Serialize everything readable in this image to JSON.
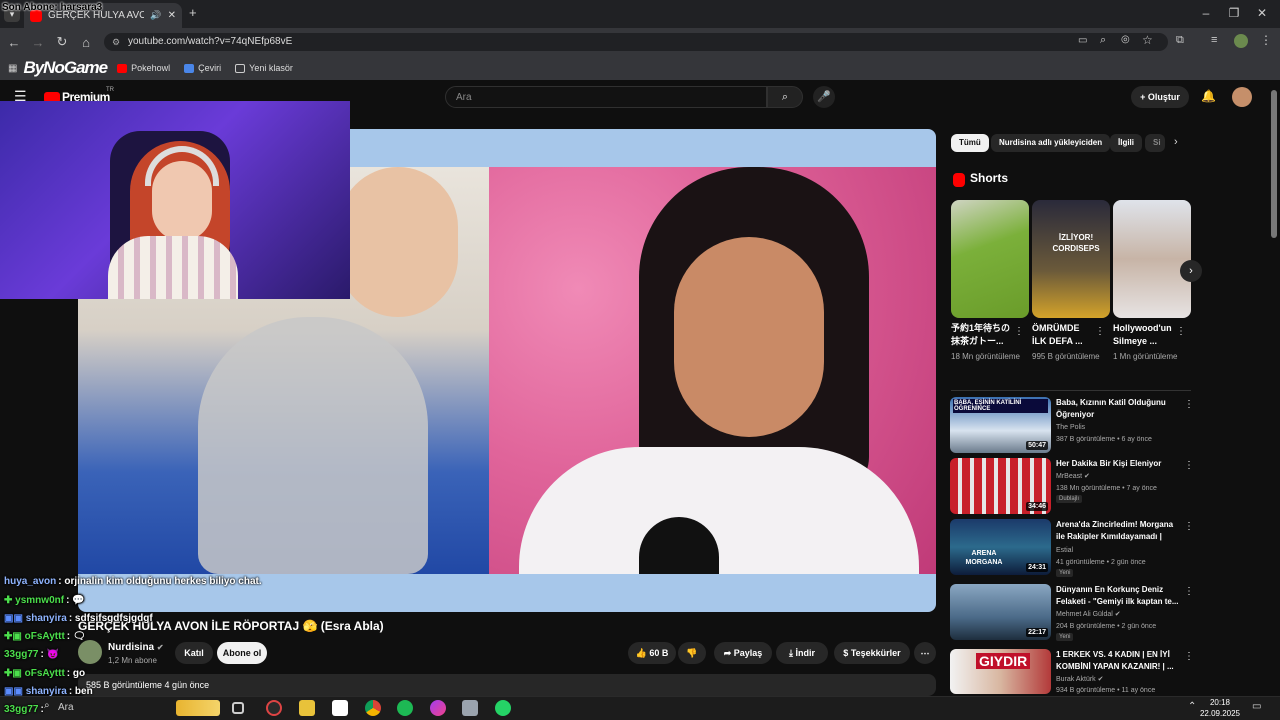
{
  "overlay": {
    "stream_title": "Son Abone: harsara3"
  },
  "browser": {
    "tab_title": "GERÇEK HULYA AVON İLE R",
    "new_tab": "+",
    "url": "youtube.com/watch?v=74qNEfp68vE",
    "bookmarks": [
      "Pokehowl",
      "Çeviri",
      "Yeni klasör"
    ],
    "brand_logo": "ByNoGame"
  },
  "youtube": {
    "brand": "Premium",
    "brand_sup": "TR",
    "search_placeholder": "Ara",
    "create_label": "Oluştur"
  },
  "video": {
    "title": "GERÇEK HULYA AVON İLE RÖPORTAJ 🫣 (Esra Abla)",
    "channel": "Nurdisina",
    "verified": "✔",
    "subscribers": "1,2 Mn abone",
    "join_label": "Katıl",
    "subscribe_label": "Abone ol",
    "likes": "60 B",
    "share_label": "Paylaş",
    "download_label": "İndir",
    "thanks_label": "Teşekkürler",
    "more_label": "⋯",
    "description_stats": "585 B görüntüleme  4 gün önce"
  },
  "chips": [
    "Tümü",
    "Nurdisina adlı yükleyiciden",
    "İlgili",
    "Si"
  ],
  "shorts": {
    "heading": "Shorts",
    "items": [
      {
        "title": "予約1年待ちの抹茶ガトー...",
        "views": "18 Mn görüntüleme"
      },
      {
        "title": "ÖMRÜMDE İLK DEFA ...",
        "views": "995 B görüntüleme",
        "thumb_text": "İZLİYOR! CORDISEPS"
      },
      {
        "title": "Hollywood'un Silmeye ...",
        "views": "1 Mn görüntüleme"
      }
    ]
  },
  "recommendations": [
    {
      "title": "Baba, Kızının Katil Olduğunu Öğreniyor",
      "channel": "The Polis",
      "meta": "387 B görüntüleme • 6 ay önce",
      "duration": "50:47",
      "thumb_text": "BABA, EŞİNİN KATİLİNİ ÖĞRENİNCE",
      "badge": ""
    },
    {
      "title": "Her Dakika Bir Kişi Eleniyor",
      "channel": "MrBeast",
      "meta": "138 Mn görüntüleme • 7 ay önce",
      "duration": "34:46",
      "thumb_text": "",
      "badge": "Dublajlı"
    },
    {
      "title": "Arena'da Zincirledim! Morgana ile Rakipler Kımıldayamadı | Lo...",
      "channel": "Estial",
      "meta": "41 görüntüleme • 2 gün önce",
      "duration": "24:31",
      "thumb_text": "ARENA MORGANA",
      "badge": "Yeni"
    },
    {
      "title": "Dünyanın En Korkunç Deniz Felaketi - \"Gemiyi ilk kaptan te...",
      "channel": "Mehmet Ali Güldal",
      "meta": "204 B görüntüleme • 2 gün önce",
      "duration": "22:17",
      "thumb_text": "",
      "badge": "Yeni"
    },
    {
      "title": "1 ERKEK VS. 4 KADIN | EN İYİ KOMBİNİ YAPAN KAZANIR! | ...",
      "channel": "Burak Aktürk",
      "meta": "934 B görüntüleme • 11 ay önce",
      "duration": "",
      "thumb_text": "GIYDIR",
      "badge": ""
    }
  ],
  "chat": [
    {
      "user": "huya_avon",
      "msg": ": orjinalin kim olduğunu herkes biliyo chat.",
      "color": "#5b8cff"
    },
    {
      "user": "ysmnw0nf",
      "msg": ": 💬",
      "color": "#4cdf4c"
    },
    {
      "user": "shanyira",
      "msg": ": sdfsifsgdfsjgdgf",
      "color": "#8fb4ff"
    },
    {
      "user": "oFsAyttt",
      "msg": ": 🗨",
      "color": "#4cdf4c"
    },
    {
      "user": "33gg77",
      "msg": ": 😈",
      "color": "#4cdf4c"
    },
    {
      "user": "oFsAyttt",
      "msg": ": go",
      "color": "#4cdf4c"
    },
    {
      "user": "shanyira",
      "msg": ": ben",
      "color": "#8fb4ff"
    },
    {
      "user": "33gg77",
      "msg": ": ",
      "color": "#4cdf4c"
    }
  ],
  "taskbar": {
    "search_label": "Ara",
    "time": "20:18",
    "date": "22.09.2025"
  },
  "colors": {
    "youtube_red": "#ff0000",
    "background": "#0f0f0f",
    "chip": "#272727"
  }
}
